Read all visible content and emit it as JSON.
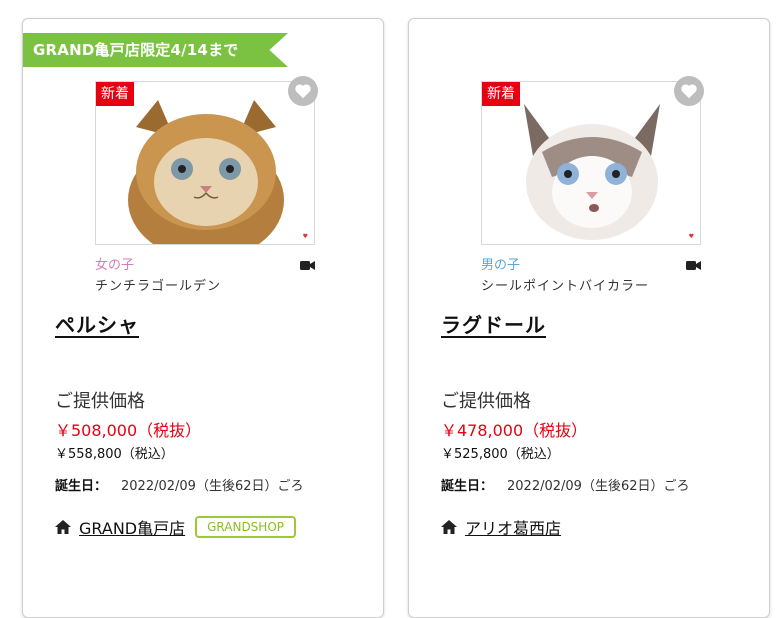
{
  "cards": [
    {
      "ribbon": "GRAND亀戸店限定4/14まで",
      "badge": "新着",
      "gender": "女の子",
      "coat": "チンチラゴールデン",
      "breed": "ペルシャ",
      "price_label": "ご提供価格",
      "price_ex_tax": "￥508,000（税抜）",
      "price_in_tax": "￥558,800（税込）",
      "birth_label": "誕生日：",
      "birth_value": "2022/02/09（生後62日）ごろ",
      "shop_name": "GRAND亀戸店",
      "shop_tag": "GRANDSHOP"
    },
    {
      "badge": "新着",
      "gender": "男の子",
      "coat": "シールポイントバイカラー",
      "breed": "ラグドール",
      "price_label": "ご提供価格",
      "price_ex_tax": "￥478,000（税抜）",
      "price_in_tax": "￥525,800（税込）",
      "birth_label": "誕生日：",
      "birth_value": "2022/02/09（生後62日）ごろ",
      "shop_name": "アリオ葛西店"
    }
  ],
  "colors": {
    "ribbon": "#7cc242",
    "new_badge": "#e60012",
    "price": "#e60012",
    "female": "#d77fb5",
    "male": "#5aa7dc",
    "shop_tag": "#9bc93a"
  },
  "icons": [
    "heart-icon",
    "video-camera-icon",
    "home-icon"
  ]
}
